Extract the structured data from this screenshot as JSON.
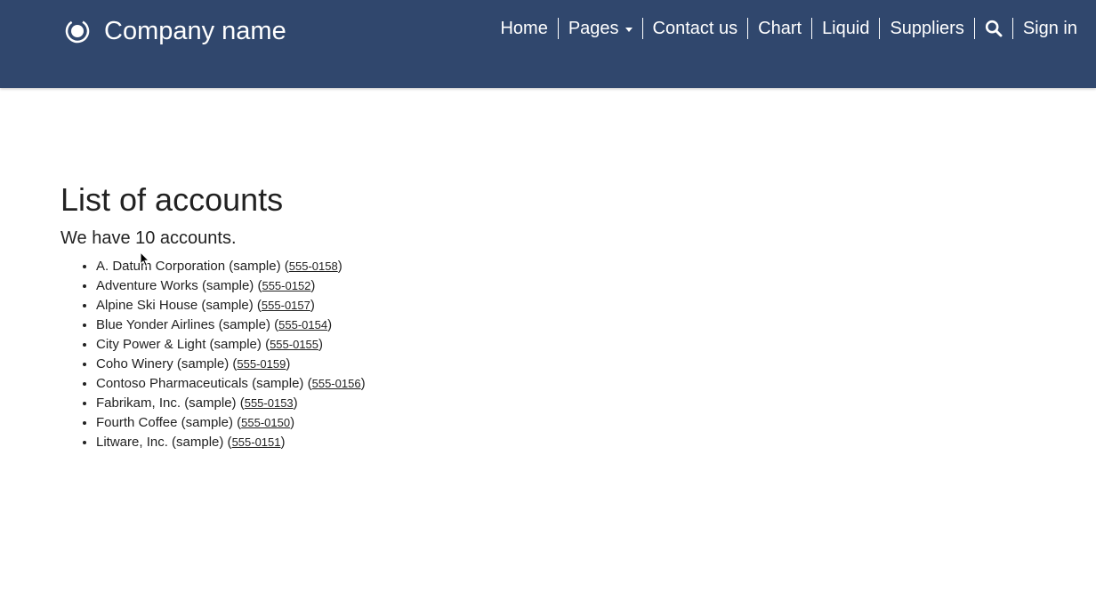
{
  "header": {
    "brand_name": "Company name",
    "nav": [
      {
        "label": "Home"
      },
      {
        "label": "Pages",
        "has_dropdown": true
      },
      {
        "label": "Contact us"
      },
      {
        "label": "Chart"
      },
      {
        "label": "Liquid"
      },
      {
        "label": "Suppliers"
      },
      {
        "label": "",
        "icon": "search-icon"
      },
      {
        "label": "Sign in"
      }
    ]
  },
  "main": {
    "title": "List of accounts",
    "summary": "We have 10 accounts.",
    "accounts": [
      {
        "name": "A. Datum Corporation (sample)",
        "phone": "555-0158"
      },
      {
        "name": "Adventure Works (sample)",
        "phone": "555-0152"
      },
      {
        "name": "Alpine Ski House (sample)",
        "phone": "555-0157"
      },
      {
        "name": "Blue Yonder Airlines (sample)",
        "phone": "555-0154"
      },
      {
        "name": "City Power & Light (sample)",
        "phone": "555-0155"
      },
      {
        "name": "Coho Winery (sample)",
        "phone": "555-0159"
      },
      {
        "name": "Contoso Pharmaceuticals (sample)",
        "phone": "555-0156"
      },
      {
        "name": "Fabrikam, Inc. (sample)",
        "phone": "555-0153"
      },
      {
        "name": "Fourth Coffee (sample)",
        "phone": "555-0150"
      },
      {
        "name": "Litware, Inc. (sample)",
        "phone": "555-0151"
      }
    ]
  },
  "colors": {
    "header_bg": "#30476d",
    "header_text": "#ffffff",
    "body_text": "#222222"
  }
}
